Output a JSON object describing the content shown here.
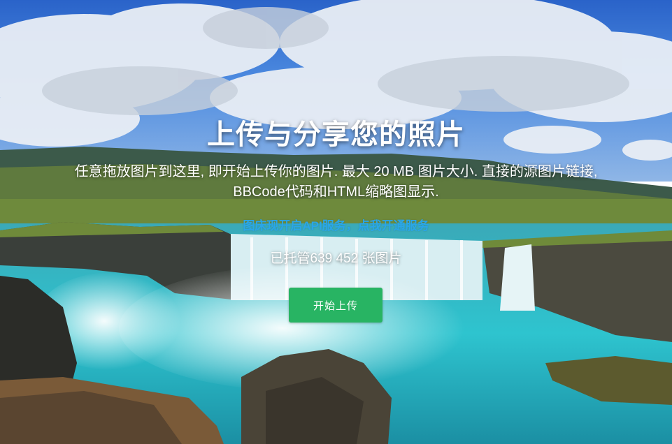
{
  "hero": {
    "title": "上传与分享您的照片",
    "subtitle": "任意拖放图片到这里, 即开始上传你的图片. 最大 20 MB 图片大小. 直接的源图片链接, BBCode代码和HTML缩略图显示.",
    "api_link": "图床现开启API服务，点我开通服务",
    "hosted_text": "已托管639 452 张图片",
    "upload_button": "开始上传",
    "background_image": "waterfall-landscape-photo"
  },
  "colors": {
    "button_green": "#28b463",
    "link_blue": "#2aa6e8",
    "text_white": "#ffffff"
  }
}
